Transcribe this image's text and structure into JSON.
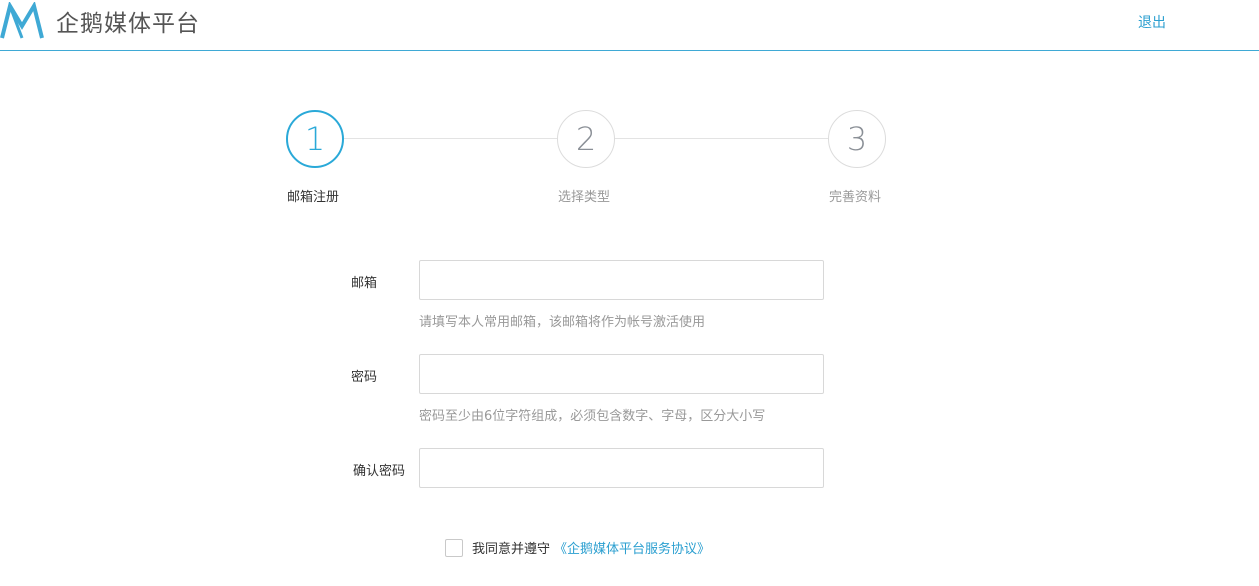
{
  "header": {
    "logo_text": "企鹅媒体平台",
    "logout_label": "退出",
    "accent_color": "#2aa9d8"
  },
  "steps": [
    {
      "number": "1",
      "label": "邮箱注册",
      "active": true
    },
    {
      "number": "2",
      "label": "选择类型",
      "active": false
    },
    {
      "number": "3",
      "label": "完善资料",
      "active": false
    }
  ],
  "form": {
    "email": {
      "label": "邮箱",
      "value": "",
      "hint": "请填写本人常用邮箱，该邮箱将作为帐号激活使用"
    },
    "password": {
      "label": "密码",
      "value": "",
      "hint": "密码至少由6位字符组成，必须包含数字、字母，区分大小写"
    },
    "confirm_password": {
      "label": "确认密码",
      "value": ""
    }
  },
  "agreement": {
    "text": "我同意并遵守",
    "link_text": "《企鹅媒体平台服务协议》",
    "checked": false
  }
}
